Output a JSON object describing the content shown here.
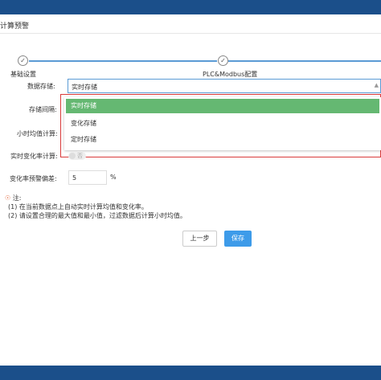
{
  "dialog": {
    "title": "计算预警"
  },
  "steps": [
    {
      "label": "基础设置",
      "icon": "check-icon"
    },
    {
      "label": "PLC&Modbus配置",
      "icon": "check-icon"
    }
  ],
  "form": {
    "storage_mode": {
      "label": "数据存储:",
      "value": "实时存储",
      "options": [
        "实时存储",
        "变化存储",
        "定时存储"
      ],
      "selected_index": 0
    },
    "storage_interval": {
      "label": "存储间隔:"
    },
    "hourly_avg": {
      "label": "小时均值计算:"
    },
    "realtime_change": {
      "label": "实时变化率计算:",
      "toggle_text": "否"
    },
    "change_threshold": {
      "label": "变化率预警偏差:",
      "value": "5",
      "unit": "%"
    }
  },
  "notes": {
    "title": "注:",
    "lines": [
      "(1) 在当前数据点上自动实时计算均值和变化率。",
      "(2) 请设置合理的最大值和最小值，过滤数据后计算小时均值。"
    ]
  },
  "buttons": {
    "prev": "上一步",
    "save": "保存"
  },
  "colors": {
    "accent": "#3d9be9",
    "selected": "#65b872",
    "topbar": "#1b4f8a",
    "highlight_frame": "#d93a3a"
  }
}
